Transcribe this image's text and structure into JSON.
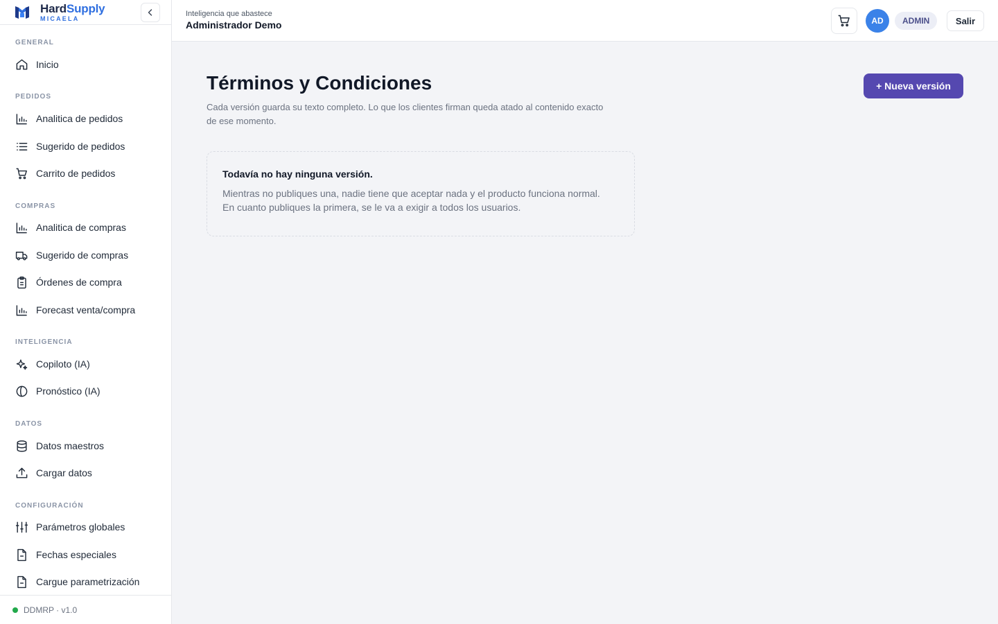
{
  "brand": {
    "name_part1": "Hard",
    "name_part2": "Supply",
    "subtitle": "MICAELA"
  },
  "sidebar": {
    "sections": [
      {
        "label": "GENERAL",
        "items": [
          {
            "label": "Inicio",
            "icon": "home-icon"
          }
        ]
      },
      {
        "label": "PEDIDOS",
        "items": [
          {
            "label": "Analitica de pedidos",
            "icon": "bar-chart-icon"
          },
          {
            "label": "Sugerido de pedidos",
            "icon": "list-icon"
          },
          {
            "label": "Carrito de pedidos",
            "icon": "cart-icon"
          }
        ]
      },
      {
        "label": "COMPRAS",
        "items": [
          {
            "label": "Analitica de compras",
            "icon": "bar-chart-icon"
          },
          {
            "label": "Sugerido de compras",
            "icon": "truck-icon"
          },
          {
            "label": "Órdenes de compra",
            "icon": "clipboard-icon"
          },
          {
            "label": "Forecast venta/compra",
            "icon": "bar-chart-icon"
          }
        ]
      },
      {
        "label": "INTELIGENCIA",
        "items": [
          {
            "label": "Copiloto (IA)",
            "icon": "sparkles-icon"
          },
          {
            "label": "Pronóstico (IA)",
            "icon": "brain-icon"
          }
        ]
      },
      {
        "label": "DATOS",
        "items": [
          {
            "label": "Datos maestros",
            "icon": "database-icon"
          },
          {
            "label": "Cargar datos",
            "icon": "upload-icon"
          }
        ]
      },
      {
        "label": "CONFIGURACIÓN",
        "items": [
          {
            "label": "Parámetros globales",
            "icon": "sliders-icon"
          },
          {
            "label": "Fechas especiales",
            "icon": "file-icon"
          },
          {
            "label": "Cargue parametrización",
            "icon": "file-icon"
          }
        ]
      }
    ],
    "footer": "DDMRP · v1.0",
    "status_color": "#22a94b"
  },
  "header": {
    "tagline": "Inteligencia que abastece",
    "title": "Administrador Demo",
    "avatar_initials": "AD",
    "role": "ADMIN",
    "logout_label": "Salir"
  },
  "main": {
    "title": "Términos y Condiciones",
    "description": "Cada versión guarda su texto completo. Lo que los clientes firman queda atado al contenido exacto de ese momento.",
    "new_version_label": "+ Nueva versión",
    "empty_title": "Todavía no hay ninguna versión.",
    "empty_body": "Mientras no publiques una, nadie tiene que aceptar nada y el producto funciona normal. En cuanto publiques la primera, se le va a exigir a todos los usuarios."
  },
  "colors": {
    "accent": "#5548b0",
    "brand_blue": "#2f6fe0",
    "avatar_bg": "#3b82e8"
  }
}
